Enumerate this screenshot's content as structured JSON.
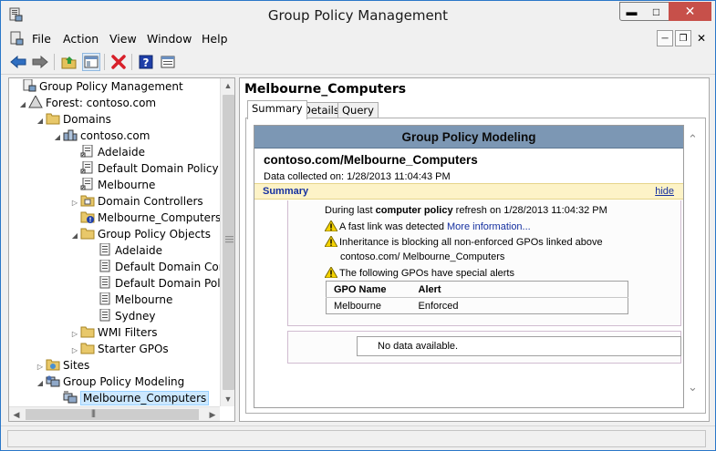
{
  "window": {
    "title": "Group Policy Management",
    "min_icon": "minimize-icon",
    "max_icon": "maximize-icon",
    "close_icon": "close-icon"
  },
  "menu": {
    "items": [
      "File",
      "Action",
      "View",
      "Window",
      "Help"
    ]
  },
  "toolbar": {
    "icons": [
      "back-icon",
      "forward-icon",
      "up-folder-icon",
      "show-hide-tree-icon",
      "delete-icon",
      "help-icon",
      "properties-icon"
    ]
  },
  "tree": {
    "nodes": [
      {
        "label": "Group Policy Management",
        "icon": "gpm-icon"
      },
      {
        "label": "Forest: contoso.com",
        "icon": "forest-icon"
      },
      {
        "label": "Domains",
        "icon": "folder-icon"
      },
      {
        "label": "contoso.com",
        "icon": "domain-icon"
      },
      {
        "label": "Adelaide",
        "icon": "gpo-link-icon"
      },
      {
        "label": "Default Domain Policy",
        "icon": "gpo-link-icon"
      },
      {
        "label": "Melbourne",
        "icon": "gpo-link-icon"
      },
      {
        "label": "Domain Controllers",
        "icon": "ou-icon"
      },
      {
        "label": "Melbourne_Computers",
        "icon": "ou-warning-icon"
      },
      {
        "label": "Group Policy Objects",
        "icon": "folder-icon"
      },
      {
        "label": "Adelaide",
        "icon": "gpo-icon"
      },
      {
        "label": "Default Domain Cont",
        "icon": "gpo-icon"
      },
      {
        "label": "Default Domain Polic",
        "icon": "gpo-icon"
      },
      {
        "label": "Melbourne",
        "icon": "gpo-icon"
      },
      {
        "label": "Sydney",
        "icon": "gpo-icon"
      },
      {
        "label": "WMI Filters",
        "icon": "folder-icon"
      },
      {
        "label": "Starter GPOs",
        "icon": "folder-icon"
      },
      {
        "label": "Sites",
        "icon": "sites-icon"
      },
      {
        "label": "Group Policy Modeling",
        "icon": "modeling-icon"
      },
      {
        "label": "Melbourne_Computers",
        "icon": "modeling-result-icon"
      }
    ]
  },
  "right": {
    "title": "Melbourne_Computers",
    "tabs": [
      "Summary",
      "Details",
      "Query"
    ],
    "report": {
      "header": "Group Policy Modeling",
      "subtitle": "contoso.com/Melbourne_Computers",
      "date": "Data collected on: 1/28/2013 11:04:43 PM",
      "section": "Summary",
      "hide": "hide",
      "line1_pre": "During last ",
      "line1_bold": "computer policy",
      "line1_post": " refresh on 1/28/2013 11:04:32 PM",
      "warn1": "A fast link was detected ",
      "warn1_link": "More information...",
      "warn2a": "Inheritance is blocking all non-enforced GPOs linked above",
      "warn2b": "contoso.com/ Melbourne_Computers",
      "warn3": "The following GPOs have special alerts",
      "table_headers": [
        "GPO Name",
        "Alert"
      ],
      "table_rows": [
        [
          "Melbourne",
          "Enforced"
        ]
      ],
      "no_data": "No data available."
    }
  },
  "colors": {
    "report_header": "#7c97b4",
    "summary_bar": "#fdf3c7",
    "link": "#1530a0",
    "selection": "#cce8ff"
  }
}
